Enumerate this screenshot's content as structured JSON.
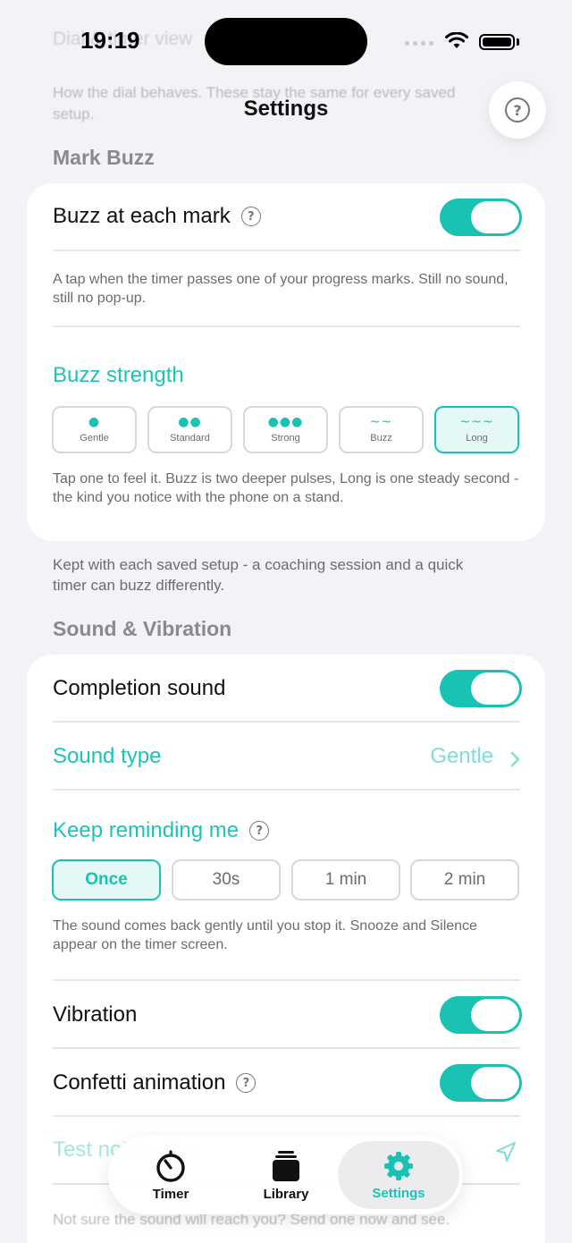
{
  "status": {
    "time": "19:19"
  },
  "nav": {
    "title": "Settings"
  },
  "ghost": {
    "top_heading": "Dial & timer view",
    "top_note": "How the dial behaves. These stay the same for every saved setup.",
    "footer_note": "Not sure the sound will reach you? Send one now and see."
  },
  "mark_buzz": {
    "header": "Mark Buzz",
    "buzz_label": "Buzz at each mark",
    "buzz_on": true,
    "buzz_note": "A tap when the timer passes one of your progress marks. Still no sound, still no pop-up.",
    "strength_label": "Buzz strength",
    "options": [
      {
        "glyph": "●",
        "label": "Gentle"
      },
      {
        "glyph": "●●",
        "label": "Standard"
      },
      {
        "glyph": "●●●",
        "label": "Strong"
      },
      {
        "glyph": "~~",
        "label": "Buzz"
      },
      {
        "glyph": "~~~",
        "label": "Long"
      }
    ],
    "selected": "Long",
    "strength_note": "Tap one to feel it. Buzz is two deeper pulses, Long is one steady second - the kind you notice with the phone on a stand.",
    "footer": "Kept with each saved setup - a coaching session and a quick timer can buzz differently."
  },
  "sound": {
    "header": "Sound & Vibration",
    "completion_label": "Completion sound",
    "completion_on": true,
    "sound_type_label": "Sound type",
    "sound_type_value": "Gentle",
    "remind_label": "Keep reminding me",
    "remind_options": [
      "Once",
      "30s",
      "1 min",
      "2 min"
    ],
    "remind_selected": "Once",
    "remind_note": "The sound comes back gently until you stop it. Snooze and Silence appear on the timer screen.",
    "vibration_label": "Vibration",
    "vibration_on": true,
    "confetti_label": "Confetti animation",
    "confetti_on": true,
    "test_label": "Test notification"
  },
  "tabbar": {
    "tabs": [
      {
        "label": "Timer",
        "icon": "timer-icon"
      },
      {
        "label": "Library",
        "icon": "library-icon"
      },
      {
        "label": "Settings",
        "icon": "gear-icon"
      }
    ],
    "active": "Settings"
  },
  "colors": {
    "accent": "#19c2b3",
    "background": "#f2f2f7",
    "card": "#ffffff"
  }
}
